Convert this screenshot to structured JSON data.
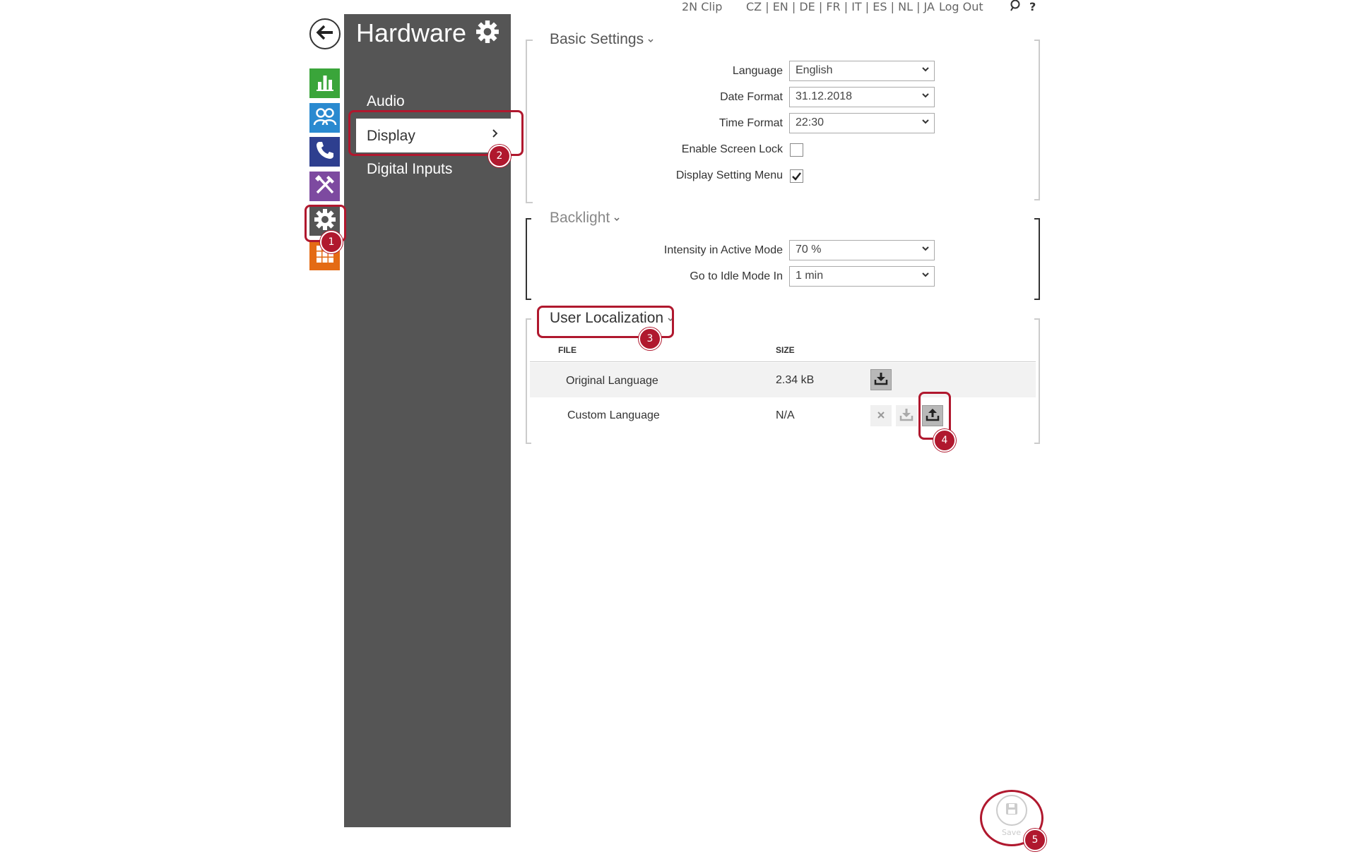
{
  "topbar": {
    "device": "2N Clip",
    "languages": "CZ | EN | DE | FR | IT | ES | NL | JA",
    "logout": "Log Out",
    "help": "?"
  },
  "sidebar": {
    "title": "Hardware",
    "items": [
      {
        "label": "Audio"
      },
      {
        "label": "Display"
      },
      {
        "label": "Digital Inputs"
      }
    ]
  },
  "basic_settings": {
    "title": "Basic Settings",
    "language_label": "Language",
    "language_value": "English",
    "date_format_label": "Date Format",
    "date_format_value": "31.12.2018",
    "time_format_label": "Time Format",
    "time_format_value": "22:30",
    "screen_lock_label": "Enable Screen Lock",
    "screen_lock_checked": false,
    "setting_menu_label": "Display Setting Menu",
    "setting_menu_checked": true
  },
  "backlight": {
    "title": "Backlight",
    "intensity_label": "Intensity in Active Mode",
    "intensity_value": "70 %",
    "idle_label": "Go to Idle Mode In",
    "idle_value": "1 min"
  },
  "user_localization": {
    "title": "User Localization",
    "col_file": "FILE",
    "col_size": "SIZE",
    "rows": [
      {
        "file": "Original Language",
        "size": "2.34 kB"
      },
      {
        "file": "Custom Language",
        "size": "N/A"
      }
    ]
  },
  "save": {
    "label": "Save"
  },
  "callouts": [
    "1",
    "2",
    "3",
    "4",
    "5"
  ],
  "colors": {
    "sidebar_bg": "#555555",
    "callout": "#b0182e",
    "tile_status": "#3aa53a",
    "tile_directory": "#2a8ad0",
    "tile_calls": "#2e3f8f",
    "tile_services": "#7d4aa0",
    "tile_hardware": "#555555",
    "tile_system": "#e46b15"
  }
}
